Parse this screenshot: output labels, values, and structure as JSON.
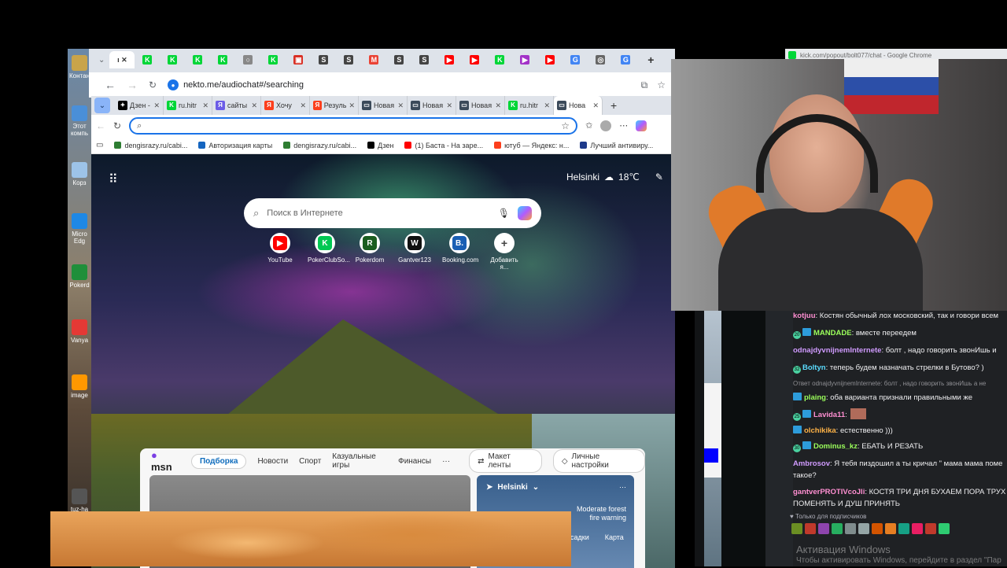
{
  "desktop": {
    "icons": [
      {
        "label": "Контан",
        "color": "#c9a44a"
      },
      {
        "label": "Этот компь",
        "color": "#4a8fd8"
      },
      {
        "label": "Корз",
        "color": "#9dc3e8"
      },
      {
        "label": "Micro Edg",
        "color": "#1e88e5"
      },
      {
        "label": "Pokerd",
        "color": "#1f8f3a"
      },
      {
        "label": "Vanya",
        "color": "#e53935"
      },
      {
        "label": "image",
        "color": "#ff9800"
      },
      {
        "label": "tuz-ha",
        "color": "#555555"
      }
    ]
  },
  "chrome": {
    "tabs": [
      {
        "icon": "K",
        "color": "#00d637"
      },
      {
        "icon": "K",
        "color": "#00d637"
      },
      {
        "icon": "K",
        "color": "#00d637"
      },
      {
        "icon": "K",
        "color": "#00d637"
      },
      {
        "icon": "○",
        "color": "#888888"
      },
      {
        "icon": "K",
        "color": "#00d637"
      },
      {
        "icon": "▣",
        "color": "#d93025"
      },
      {
        "icon": "S",
        "color": "#444444"
      },
      {
        "icon": "S",
        "color": "#444444"
      },
      {
        "icon": "M",
        "color": "#ea4335"
      },
      {
        "icon": "S",
        "color": "#444444"
      },
      {
        "icon": "S",
        "color": "#444444"
      },
      {
        "icon": "▶",
        "color": "#ff0000"
      },
      {
        "icon": "▶",
        "color": "#ff0000"
      },
      {
        "icon": "K",
        "color": "#00d637"
      },
      {
        "icon": "▶",
        "color": "#a333c8"
      },
      {
        "icon": "▶",
        "color": "#ff0000"
      },
      {
        "icon": "G",
        "color": "#4285f4"
      },
      {
        "icon": "◎",
        "color": "#666666"
      },
      {
        "icon": "G",
        "color": "#4285f4"
      }
    ],
    "url": "nekto.me/audiochat#/searching"
  },
  "edge": {
    "tabs": [
      {
        "label": "Дзен -",
        "icon": "✦",
        "color": "#000000"
      },
      {
        "label": "ru.hitr",
        "icon": "K",
        "color": "#00d637"
      },
      {
        "label": "сайты",
        "icon": "Я",
        "color": "#6c5ce7"
      },
      {
        "label": "Хочу",
        "icon": "Я",
        "color": "#fc3f1d"
      },
      {
        "label": "Резуль",
        "icon": "Я",
        "color": "#fc3f1d"
      },
      {
        "label": "Новая",
        "icon": "▭",
        "color": "#3b4a5a"
      },
      {
        "label": "Новая",
        "icon": "▭",
        "color": "#3b4a5a"
      },
      {
        "label": "Новая",
        "icon": "▭",
        "color": "#3b4a5a"
      },
      {
        "label": "ru.hitr",
        "icon": "K",
        "color": "#00d637"
      },
      {
        "label": "Нова",
        "icon": "▭",
        "color": "#3b4a5a"
      }
    ],
    "address_placeholder": "",
    "bookmarks": [
      {
        "label": "dengisrazy.ru/cabi...",
        "color": "#2e7d32"
      },
      {
        "label": "Авторизация карты",
        "color": "#1565c0"
      },
      {
        "label": "dengisrazy.ru/cabi...",
        "color": "#2e7d32"
      },
      {
        "label": "Дзен",
        "color": "#000000"
      },
      {
        "label": "(1) Баста - На заре...",
        "color": "#ff0000"
      },
      {
        "label": "ютуб — Яндекс: н...",
        "color": "#fc3f1d"
      },
      {
        "label": "Лучший антивиру...",
        "color": "#1e3a8a"
      }
    ],
    "ntp": {
      "city": "Helsinki",
      "temp": "18℃",
      "search_placeholder": "Поиск в Интернете",
      "tiles": [
        {
          "label": "YouTube",
          "icon": "▶",
          "color": "#ff0000"
        },
        {
          "label": "PokerClubSo...",
          "icon": "K",
          "color": "#00c853"
        },
        {
          "label": "Pokerdom",
          "icon": "R",
          "color": "#1b5e20"
        },
        {
          "label": "Gantver123",
          "icon": "W",
          "color": "#111111"
        },
        {
          "label": "Booking.com",
          "icon": "B.",
          "color": "#1a5fb4"
        },
        {
          "label": "Добавить я...",
          "icon": "+",
          "color": "#ffffff"
        }
      ],
      "msn": {
        "logo": "msn",
        "tabs": [
          "Подборка",
          "Новости",
          "Спорт",
          "Казуальные игры",
          "Финансы"
        ],
        "more": "···",
        "layout_btn": "Макет ленты",
        "settings_btn": "Личные настройки",
        "weather": {
          "city": "Helsinki",
          "alert": "Moderate forest fire warning",
          "links": [
            "Осадки",
            "Карта"
          ]
        }
      }
    }
  },
  "kick": {
    "title": "kick.com/popout/bolt077/chat - Google Chrome"
  },
  "chat": {
    "messages": [
      {
        "user": "kotjuu",
        "text": "Костян обычный лох московский, так и говори всем",
        "color": "#ff8fd2",
        "badge": "",
        "sub": false
      },
      {
        "user": "MANDADE",
        "text": "вместе переедем",
        "color": "#9bff5b",
        "badge": "20",
        "sub": true
      },
      {
        "user": "odnajdyvnijnemInternete",
        "text": "болт , надо говорить звонИшь и",
        "color": "#d09bff",
        "badge": "",
        "sub": false
      },
      {
        "user": "Boltyn",
        "text": "теперь будем назначать стрелки в Бутово? )",
        "color": "#5bdcff",
        "badge": "32",
        "sub": false
      },
      {
        "user": "",
        "text": "Ответ odnajdyvnijnemInternete: болт , надо говорить звонИшь а не",
        "color": "#8e8e93",
        "badge": "",
        "sub": false,
        "reply": true
      },
      {
        "user": "plaing",
        "text": "оба варианта признали правильными же",
        "color": "#9bff5b",
        "badge": "",
        "sub": true
      },
      {
        "user": "Lavida11",
        "text": "",
        "color": "#ff8fd2",
        "badge": "25",
        "sub": true
      },
      {
        "user": "olchikika",
        "text": "естественно )))",
        "color": "#ffb347",
        "badge": "",
        "sub": true
      },
      {
        "user": "Dominus_kz",
        "text": "ЕБАТЬ И РЕЗАТЬ",
        "color": "#9bff5b",
        "badge": "30",
        "sub": true
      },
      {
        "user": "Ambrosov",
        "text": "Я тебя пиздошил а ты кричал \" мама мама поме",
        "color": "#d09bff",
        "badge": "",
        "sub": false
      },
      {
        "user": "",
        "text": "такое?",
        "color": "#efeff1",
        "badge": "",
        "sub": false
      },
      {
        "user": "gantverPROTIVcoJli",
        "text": "КОСТЯ ТРИ ДНЯ БУХАЕМ ПОРА ТРУХ",
        "color": "#ff8fd2",
        "badge": "",
        "sub": false
      },
      {
        "user": "",
        "text": "ПОМЕНЯТЬ И ДУШ ПРИНЯТЬ",
        "color": "#efeff1",
        "badge": "",
        "sub": false
      }
    ],
    "subonly": "Только для подписчиков",
    "emotes": [
      "#6b8e23",
      "#c0392b",
      "#8e44ad",
      "#27ae60",
      "#7f8c8d",
      "#95a5a6",
      "#d35400",
      "#e67e22",
      "#16a085",
      "#e91e63",
      "#c0392b",
      "#2ecc71"
    ]
  },
  "activation": {
    "line1": "Активация Windows",
    "line2": "Чтобы активировать Windows, перейдите в раздел \"Пар"
  }
}
